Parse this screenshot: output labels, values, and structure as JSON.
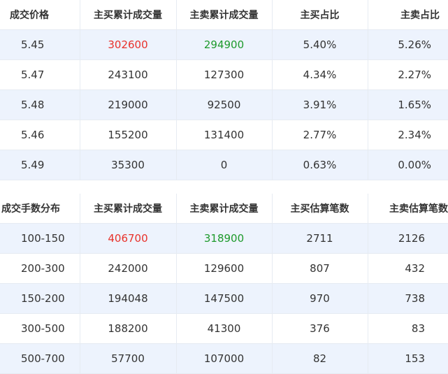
{
  "table1": {
    "headers": [
      "成交价格",
      "主买累计成交量",
      "主卖累计成交量",
      "主买占比",
      "主卖占比"
    ],
    "rows": [
      [
        "5.45",
        "302600",
        "294900",
        "5.40%",
        "5.26%"
      ],
      [
        "5.47",
        "243100",
        "127300",
        "4.34%",
        "2.27%"
      ],
      [
        "5.48",
        "219000",
        "92500",
        "3.91%",
        "1.65%"
      ],
      [
        "5.46",
        "155200",
        "131400",
        "2.77%",
        "2.34%"
      ],
      [
        "5.49",
        "35300",
        "0",
        "0.63%",
        "0.00%"
      ]
    ]
  },
  "table2": {
    "headers": [
      "成交手数分布",
      "主买累计成交量",
      "主卖累计成交量",
      "主买估算笔数",
      "主卖估算笔数"
    ],
    "rows": [
      [
        "100-150",
        "406700",
        "318900",
        "2711",
        "2126"
      ],
      [
        "200-300",
        "242000",
        "129600",
        "807",
        "432"
      ],
      [
        "150-200",
        "194048",
        "147500",
        "970",
        "738"
      ],
      [
        "300-500",
        "188200",
        "41300",
        "376",
        "83"
      ],
      [
        "500-700",
        "57700",
        "107000",
        "82",
        "153"
      ]
    ]
  },
  "colors": {
    "buy_highlight": "#e8322b",
    "sell_highlight": "#1e9a2c",
    "alt_row": "#edf3fd"
  }
}
